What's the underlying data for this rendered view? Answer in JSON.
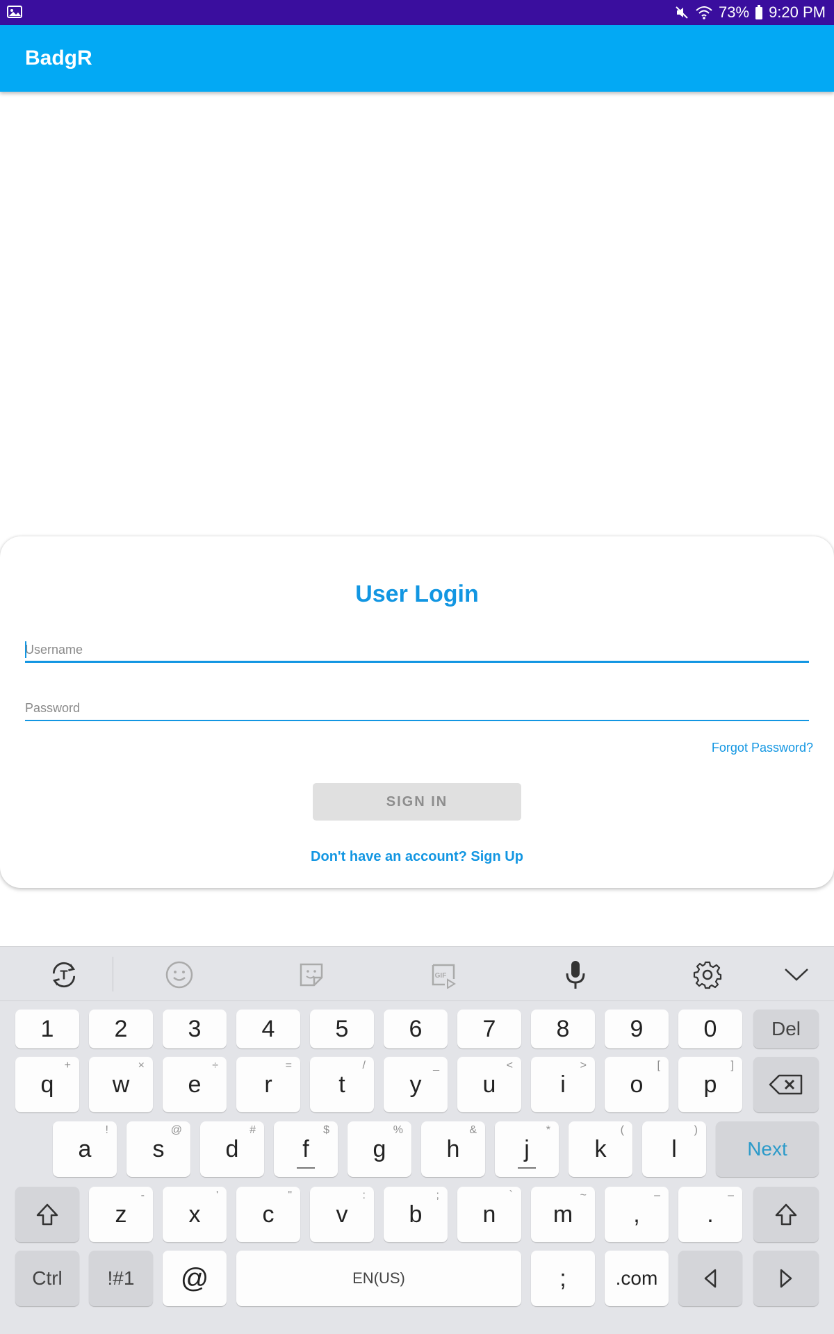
{
  "status_bar": {
    "battery": "73%",
    "time": "9:20 PM",
    "icons": [
      "image-icon",
      "mute-icon",
      "wifi-icon",
      "battery-icon"
    ]
  },
  "app_bar": {
    "title": "BadgR"
  },
  "login": {
    "title": "User Login",
    "username_placeholder": "Username",
    "password_placeholder": "Password",
    "forgot_password": "Forgot Password?",
    "sign_in": "SIGN IN",
    "sign_up": "Don't have an account? Sign Up"
  },
  "colors": {
    "status_bar": "#3a0e9e",
    "app_bar": "#03a9f4",
    "accent": "#1296e2",
    "button_disabled": "#e0e0e0"
  },
  "keyboard": {
    "toolbar_icons": [
      "translate-icon",
      "emoji-icon",
      "sticker-icon",
      "gif-icon",
      "microphone-icon",
      "settings-gear-icon",
      "collapse-keyboard-icon"
    ],
    "row_numbers": [
      "1",
      "2",
      "3",
      "4",
      "5",
      "6",
      "7",
      "8",
      "9",
      "0",
      "Del"
    ],
    "row_q": [
      {
        "label": "q",
        "hint": "+"
      },
      {
        "label": "w",
        "hint": "×"
      },
      {
        "label": "e",
        "hint": "÷"
      },
      {
        "label": "r",
        "hint": "="
      },
      {
        "label": "t",
        "hint": "/"
      },
      {
        "label": "y",
        "hint": "_"
      },
      {
        "label": "u",
        "hint": "<"
      },
      {
        "label": "i",
        "hint": ">"
      },
      {
        "label": "o",
        "hint": "["
      },
      {
        "label": "p",
        "hint": "]"
      }
    ],
    "row_a": [
      {
        "label": "a",
        "hint": "!"
      },
      {
        "label": "s",
        "hint": "@"
      },
      {
        "label": "d",
        "hint": "#"
      },
      {
        "label": "f",
        "hint": "$"
      },
      {
        "label": "g",
        "hint": "%"
      },
      {
        "label": "h",
        "hint": "&"
      },
      {
        "label": "j",
        "hint": "*"
      },
      {
        "label": "k",
        "hint": "("
      },
      {
        "label": "l",
        "hint": ")"
      }
    ],
    "next_label": "Next",
    "row_z": [
      {
        "label": "z",
        "hint": "-"
      },
      {
        "label": "x",
        "hint": "'"
      },
      {
        "label": "c",
        "hint": "\""
      },
      {
        "label": "v",
        "hint": ":"
      },
      {
        "label": "b",
        "hint": ";"
      },
      {
        "label": "n",
        "hint": "`"
      },
      {
        "label": "m",
        "hint": "~"
      },
      {
        "label": ",",
        "hint": "–"
      },
      {
        "label": ".",
        "hint": "–"
      }
    ],
    "ctrl_label": "Ctrl",
    "symbols_label": "!#1",
    "at_label": "@",
    "space_label": "EN(US)",
    "semicolon_label": ";",
    "dotcom_label": ".com"
  }
}
